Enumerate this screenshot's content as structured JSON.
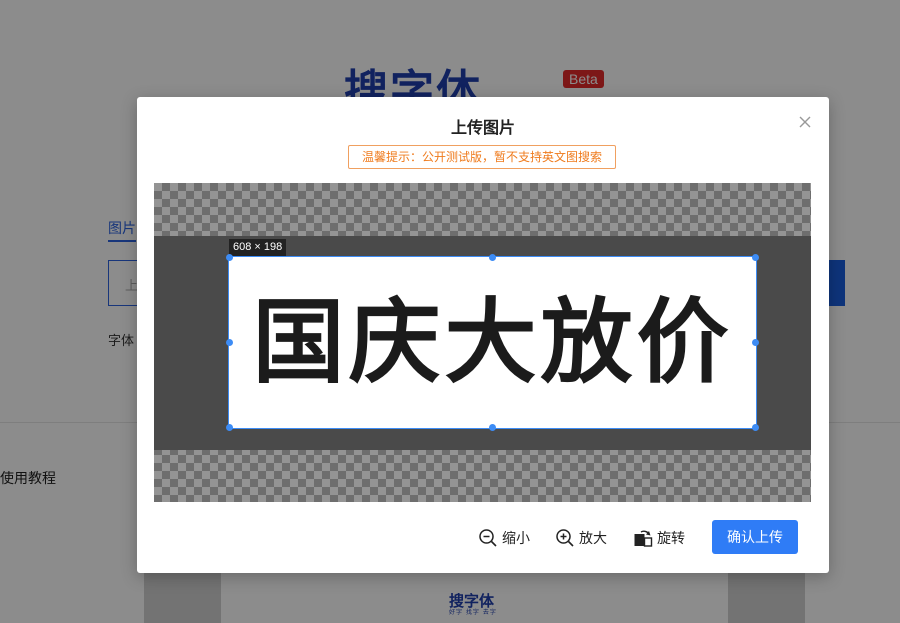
{
  "background": {
    "logo_text": "搜字体",
    "beta_badge": "Beta",
    "tab_label": "图片",
    "input_placeholder": "上",
    "helper_text": "字体",
    "tutorial_label": "使用教程",
    "footer_logo": "搜字体",
    "footer_sub": "好字 找字 去字"
  },
  "modal": {
    "title": "上传图片",
    "close_icon": "close-icon",
    "tip": "温馨提示：公开测试版，暂不支持英文图搜索",
    "crop_size_label": "608 × 198",
    "image_text": "国庆大放价",
    "tools": {
      "zoom_out": "缩小",
      "zoom_in": "放大",
      "rotate": "旋转"
    },
    "confirm_label": "确认上传"
  },
  "colors": {
    "accent": "#2f7cf6",
    "tip": "#ef7b1d",
    "brand": "#1f3fae",
    "beta": "#e32b2b"
  }
}
